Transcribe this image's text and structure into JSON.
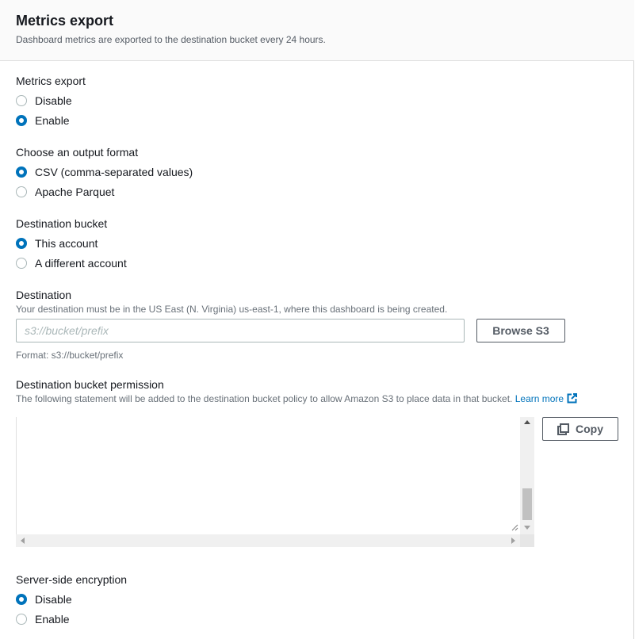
{
  "header": {
    "title": "Metrics export",
    "description": "Dashboard metrics are exported to the destination bucket every 24 hours."
  },
  "metrics_export": {
    "label": "Metrics export",
    "options": [
      {
        "label": "Disable",
        "checked": false
      },
      {
        "label": "Enable",
        "checked": true
      }
    ]
  },
  "output_format": {
    "label": "Choose an output format",
    "options": [
      {
        "label": "CSV (comma-separated values)",
        "checked": true
      },
      {
        "label": "Apache Parquet",
        "checked": false
      }
    ]
  },
  "destination_bucket": {
    "label": "Destination bucket",
    "options": [
      {
        "label": "This account",
        "checked": true
      },
      {
        "label": "A different account",
        "checked": false
      }
    ]
  },
  "destination": {
    "label": "Destination",
    "description": "Your destination must be in the US East (N. Virginia) us-east-1, where this dashboard is being created.",
    "value": "",
    "placeholder": "s3://bucket/prefix",
    "browse_label": "Browse S3",
    "format_hint": "Format: s3://bucket/prefix"
  },
  "permission": {
    "label": "Destination bucket permission",
    "description": "The following statement will be added to the destination bucket policy to allow Amazon S3 to place data in that bucket.",
    "learn_more": "Learn more",
    "policy_text": "",
    "copy_label": "Copy"
  },
  "encryption": {
    "label": "Server-side encryption",
    "options": [
      {
        "label": "Disable",
        "checked": true
      },
      {
        "label": "Enable",
        "checked": false
      }
    ]
  },
  "colors": {
    "accent": "#0073bb",
    "text": "#16191f",
    "secondary_text": "#687078",
    "header_bg": "#fafafa"
  }
}
